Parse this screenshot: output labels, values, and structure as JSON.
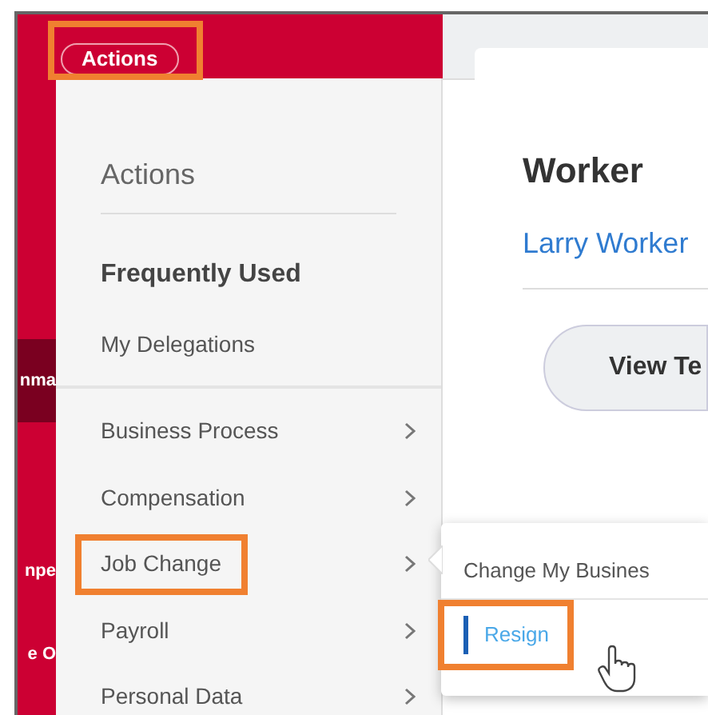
{
  "top_bar": {
    "actions_button": {
      "label": "Actions",
      "highlighted": true
    }
  },
  "side_strip": [
    {
      "text": "nma",
      "selected": true
    },
    {
      "text": "npe",
      "selected": false
    },
    {
      "text": "e O",
      "selected": false
    }
  ],
  "actions_menu": {
    "title": "Actions",
    "section_title": "Frequently Used",
    "frequent_items": [
      {
        "label": "My Delegations"
      }
    ],
    "categories": [
      {
        "label": "Business Process",
        "highlighted": false
      },
      {
        "label": "Compensation",
        "highlighted": false
      },
      {
        "label": "Job Change",
        "highlighted": true
      },
      {
        "label": "Payroll",
        "highlighted": false
      },
      {
        "label": "Personal Data",
        "highlighted": false
      }
    ]
  },
  "submenu": {
    "items": [
      {
        "label": "Change My Busines",
        "selected": false,
        "highlighted": false
      },
      {
        "label": "Resign",
        "selected": true,
        "highlighted": true
      }
    ]
  },
  "worker_card": {
    "heading": "Worker",
    "name_link": "Larry Worker",
    "button": "View Te"
  }
}
